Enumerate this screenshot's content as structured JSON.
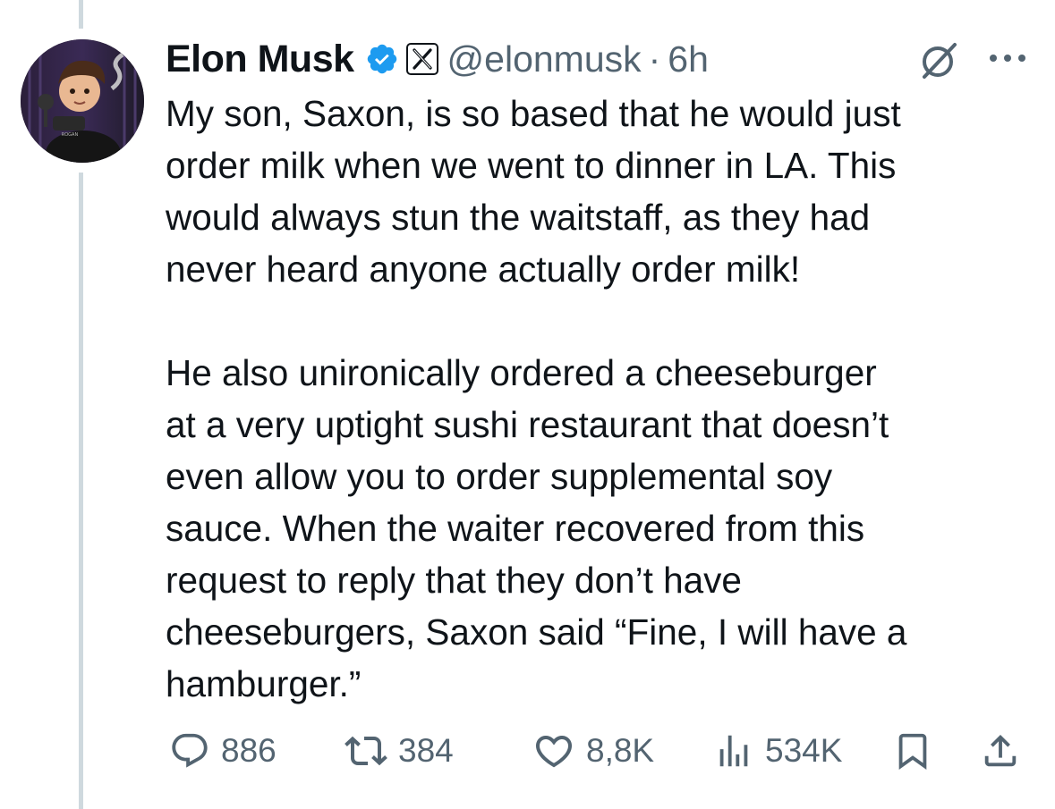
{
  "tweet": {
    "author_name": "Elon Musk",
    "handle": "@elonmusk",
    "separator": "·",
    "time": "6h",
    "paragraphs": [
      "My son, Saxon, is so based that he would just\norder milk when we went to dinner in LA. This\nwould always stun the waitstaff, as they had\nnever heard anyone actually order milk!",
      "He also unironically ordered a cheeseburger\nat a very uptight sushi restaurant that doesn’t\neven allow you to order supplemental soy\nsauce. When the waiter recovered from this\nrequest to reply that they don’t have\ncheeseburgers, Saxon said “Fine, I will have a\nhamburger.”"
    ]
  },
  "stats": {
    "replies": "886",
    "reposts": "384",
    "likes": "8,8K",
    "views": "534K"
  },
  "icons": {
    "verified": "verified-badge-icon",
    "affiliate": "x-logo-icon",
    "grok": "grok-icon",
    "more": "more-icon",
    "reply": "reply-icon",
    "repost": "repost-icon",
    "like": "heart-icon",
    "views": "views-icon",
    "bookmark": "bookmark-icon",
    "share": "share-icon"
  },
  "colors": {
    "text": "#0f1419",
    "secondary": "#536471",
    "verified": "#1d9bf0",
    "thread_line": "#cfd9de"
  }
}
